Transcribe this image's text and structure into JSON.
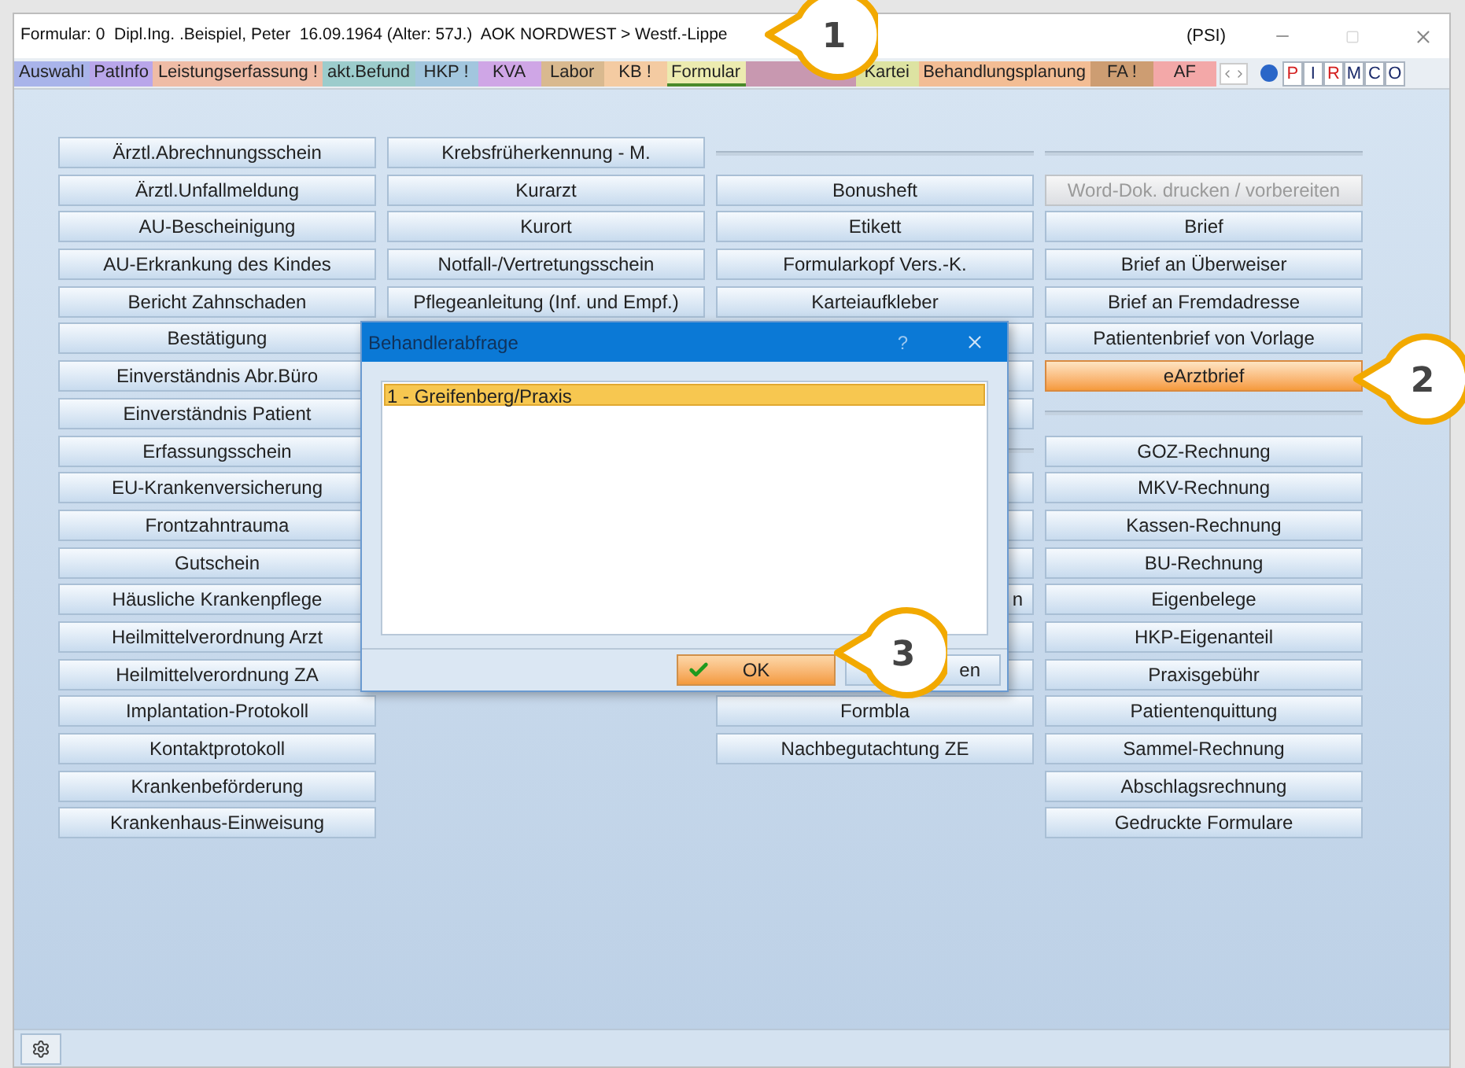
{
  "window": {
    "title": "Formular: 0  Dipl.Ing. .Beispiel, Peter  16.09.1964 (Alter: 57J.)  AOK NORDWEST > Westf.-Lippe",
    "tag": "(PSI)"
  },
  "tabs": [
    {
      "label": "Auswahl",
      "color": "#a9b4ea",
      "selected": false
    },
    {
      "label": "PatInfo",
      "color": "#b9a6ea",
      "selected": false
    },
    {
      "label": "Leistungserfassung !",
      "color": "#efbca6",
      "selected": false
    },
    {
      "label": "akt.Befund",
      "color": "#9ccccc",
      "selected": false
    },
    {
      "label": "HKP !",
      "color": "#a2c6de",
      "selected": false
    },
    {
      "label": "KVA",
      "color": "#cfa6e6",
      "selected": false
    },
    {
      "label": "Labor",
      "color": "#d9b98f",
      "selected": false
    },
    {
      "label": "KB !",
      "color": "#f4cba2",
      "selected": false
    },
    {
      "label": "Formular",
      "color": "#ecebb0",
      "selected": true
    },
    {
      "color": "#c898b0",
      "selected": false
    },
    {
      "label": "Kartei",
      "color": "#dde3a2",
      "selected": false
    },
    {
      "label": "Behandlungsplanung",
      "color": "#f3bd94",
      "selected": false
    },
    {
      "label": "FA !",
      "color": "#cd9d72",
      "selected": false
    },
    {
      "label": "AF",
      "color": "#f3a8a8",
      "selected": false
    }
  ],
  "toolbar_buttons": [
    {
      "label": "P",
      "color": "#d42020"
    },
    {
      "label": "I",
      "color": "#1a2a6a"
    },
    {
      "label": "R",
      "color": "#d42020"
    },
    {
      "label": "M",
      "color": "#1a2a6a"
    },
    {
      "label": "C",
      "color": "#1a2a6a"
    },
    {
      "label": "O",
      "color": "#1a2a6a"
    }
  ],
  "columns": [
    [
      {
        "kind": "button",
        "label": "Ärztl.Abrechnungsschein",
        "disabled": false,
        "selected": false
      },
      {
        "kind": "button",
        "label": "Ärztl.Unfallmeldung",
        "disabled": false,
        "selected": false
      },
      {
        "kind": "button",
        "label": "AU-Bescheinigung",
        "disabled": false,
        "selected": false
      },
      {
        "kind": "button",
        "label": "AU-Erkrankung des Kindes",
        "disabled": false,
        "selected": false
      },
      {
        "kind": "button",
        "label": "Bericht Zahnschaden",
        "disabled": false,
        "selected": false
      },
      {
        "kind": "button",
        "label": "Bestätigung",
        "disabled": false,
        "selected": false
      },
      {
        "kind": "button",
        "label": "Einverständnis Abr.Büro",
        "disabled": false,
        "selected": false
      },
      {
        "kind": "button",
        "label": "Einverständnis Patient",
        "disabled": false,
        "selected": false
      },
      {
        "kind": "button",
        "label": "Erfassungsschein",
        "disabled": false,
        "selected": false
      },
      {
        "kind": "button",
        "label": "EU-Krankenversicherung",
        "disabled": false,
        "selected": false
      },
      {
        "kind": "button",
        "label": "Frontzahntrauma",
        "disabled": false,
        "selected": false
      },
      {
        "kind": "button",
        "label": "Gutschein",
        "disabled": false,
        "selected": false
      },
      {
        "kind": "button",
        "label": "Häusliche Krankenpflege",
        "disabled": false,
        "selected": false
      },
      {
        "kind": "button",
        "label": "Heilmittelverordnung Arzt",
        "disabled": false,
        "selected": false
      },
      {
        "kind": "button",
        "label": "Heilmittelverordnung ZA",
        "disabled": false,
        "selected": false
      },
      {
        "kind": "button",
        "label": "Implantation-Protokoll",
        "disabled": false,
        "selected": false
      },
      {
        "kind": "button",
        "label": "Kontaktprotokoll",
        "disabled": false,
        "selected": false
      },
      {
        "kind": "button",
        "label": "Krankenbeförderung",
        "disabled": false,
        "selected": false
      },
      {
        "kind": "button",
        "label": "Krankenhaus-Einweisung",
        "disabled": false,
        "selected": false
      }
    ],
    [
      {
        "kind": "button",
        "label": "Krebsfrüherkennung - M.",
        "disabled": false,
        "selected": false
      },
      {
        "kind": "button",
        "label": "Kurarzt",
        "disabled": false,
        "selected": false
      },
      {
        "kind": "button",
        "label": "Kurort",
        "disabled": false,
        "selected": false
      },
      {
        "kind": "button",
        "label": "Notfall-/Vertretungsschein",
        "disabled": false,
        "selected": false
      },
      {
        "kind": "button",
        "label": "Pflegeanleitung (Inf. und Empf.)",
        "disabled": false,
        "selected": false
      }
    ],
    [
      {
        "kind": "separator"
      },
      {
        "kind": "button",
        "label": "Bonusheft",
        "disabled": false,
        "selected": false
      },
      {
        "kind": "button",
        "label": "Etikett",
        "disabled": false,
        "selected": false
      },
      {
        "kind": "button",
        "label": "Formularkopf Vers.-K.",
        "disabled": false,
        "selected": false
      },
      {
        "kind": "button",
        "label": "Karteiaufkleber",
        "disabled": false,
        "selected": false
      },
      {
        "kind": "covered"
      },
      {
        "kind": "covered"
      },
      {
        "kind": "covered"
      },
      {
        "kind": "separator"
      },
      {
        "kind": "covered"
      },
      {
        "kind": "covered"
      },
      {
        "kind": "covered"
      },
      {
        "kind": "covered",
        "label": "n"
      },
      {
        "kind": "covered"
      },
      {
        "kind": "covered"
      },
      {
        "kind": "button",
        "label": "Formbla",
        "disabled": false,
        "selected": false
      },
      {
        "kind": "button",
        "label": "Nachbegutachtung ZE",
        "disabled": false,
        "selected": false
      }
    ],
    [
      {
        "kind": "separator"
      },
      {
        "kind": "button",
        "label": "Word-Dok. drucken / vorbereiten",
        "disabled": true,
        "selected": false
      },
      {
        "kind": "button",
        "label": "Brief",
        "disabled": false,
        "selected": false
      },
      {
        "kind": "button",
        "label": "Brief an Überweiser",
        "disabled": false,
        "selected": false
      },
      {
        "kind": "button",
        "label": "Brief an Fremdadresse",
        "disabled": false,
        "selected": false
      },
      {
        "kind": "button",
        "label": "Patientenbrief von Vorlage",
        "disabled": false,
        "selected": false
      },
      {
        "kind": "button",
        "label": "eArztbrief",
        "disabled": false,
        "selected": true
      },
      {
        "kind": "separator"
      },
      {
        "kind": "button",
        "label": "GOZ-Rechnung",
        "disabled": false,
        "selected": false
      },
      {
        "kind": "button",
        "label": "MKV-Rechnung",
        "disabled": false,
        "selected": false
      },
      {
        "kind": "button",
        "label": "Kassen-Rechnung",
        "disabled": false,
        "selected": false
      },
      {
        "kind": "button",
        "label": "BU-Rechnung",
        "disabled": false,
        "selected": false
      },
      {
        "kind": "button",
        "label": "Eigenbelege",
        "disabled": false,
        "selected": false
      },
      {
        "kind": "button",
        "label": "HKP-Eigenanteil",
        "disabled": false,
        "selected": false
      },
      {
        "kind": "button",
        "label": "Praxisgebühr",
        "disabled": false,
        "selected": false
      },
      {
        "kind": "button",
        "label": "Patientenquittung",
        "disabled": false,
        "selected": false
      },
      {
        "kind": "button",
        "label": "Sammel-Rechnung",
        "disabled": false,
        "selected": false
      },
      {
        "kind": "button",
        "label": "Abschlagsrechnung",
        "disabled": false,
        "selected": false
      },
      {
        "kind": "button",
        "label": "Gedruckte Formulare",
        "disabled": false,
        "selected": false
      }
    ]
  ],
  "dialog": {
    "title": "Behandlerabfrage",
    "help": "?",
    "items": [
      {
        "label": "1 - Greifenberg/Praxis",
        "selected": true
      }
    ],
    "ok": "OK",
    "cancel": "en"
  },
  "callouts": [
    {
      "number": "1"
    },
    {
      "number": "2"
    },
    {
      "number": "3"
    }
  ]
}
